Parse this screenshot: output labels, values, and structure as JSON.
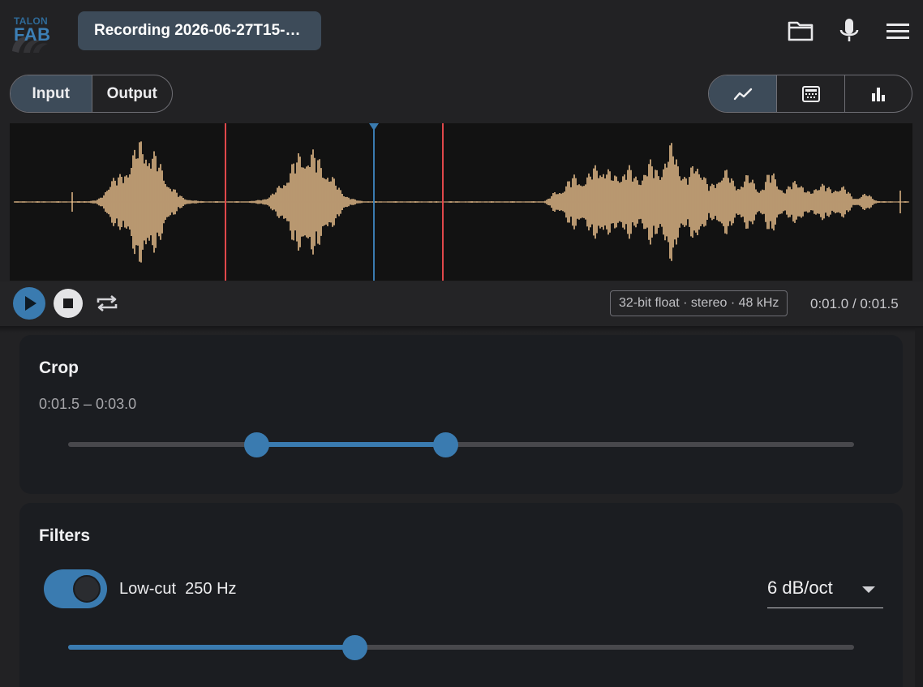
{
  "app": {
    "logo_small": "TALON",
    "logo_big": "FAB",
    "recording_title": "Recording 2026-06-27T15-…"
  },
  "toolbar": {
    "icons": [
      "folder-icon",
      "microphone-icon",
      "menu-icon"
    ]
  },
  "source_tabs": [
    {
      "label": "Input",
      "selected": true
    },
    {
      "label": "Output",
      "selected": false
    }
  ],
  "view_modes": [
    {
      "icon": "waveform-line-icon",
      "selected": true
    },
    {
      "icon": "spectrogram-icon",
      "selected": false
    },
    {
      "icon": "bar-chart-icon",
      "selected": false
    }
  ],
  "waveform": {
    "color": "#e2b988",
    "crop_marker_color": "#e0474a",
    "playhead_color": "#3a7bb0"
  },
  "transport": {
    "format": "32-bit float · stereo · 48 kHz",
    "time": "0:01.0 / 0:01.5"
  },
  "crop": {
    "title": "Crop",
    "range_text": "0:01.5 – 0:03.0",
    "start_fraction": 0.24,
    "end_fraction": 0.48
  },
  "filters": {
    "title": "Filters",
    "lowcut_enabled": true,
    "lowcut_label": "Low-cut  250 Hz",
    "slope_value": "6 dB/oct",
    "lowcut_fraction": 0.365
  },
  "colors": {
    "accent": "#3a7bb0",
    "selected_bg": "#3d4b59",
    "background": "#222224",
    "card": "#1b1d21"
  }
}
